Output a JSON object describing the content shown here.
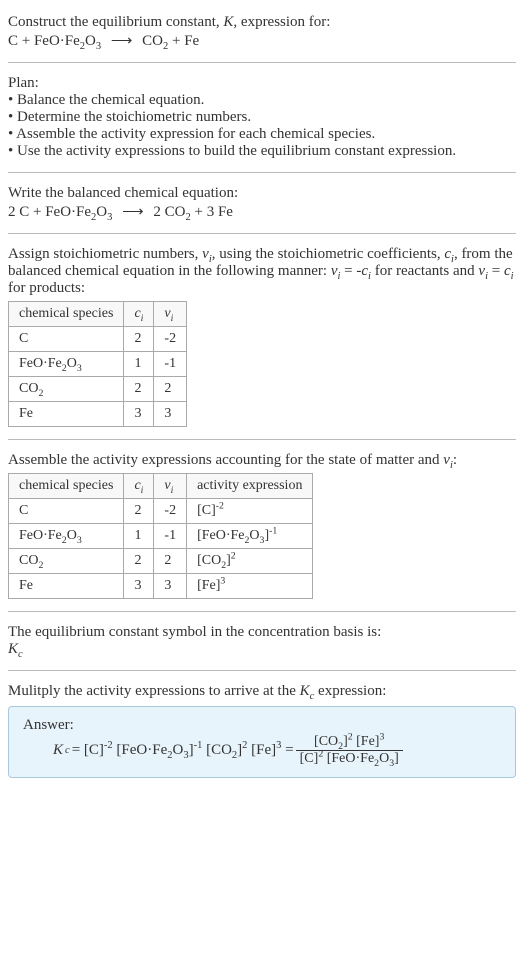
{
  "title_line1": "Construct the equilibrium constant, ",
  "title_K": "K",
  "title_line1b": ", expression for:",
  "eq_unbalanced": {
    "lhs": "C + FeO·Fe",
    "lhs_sub1": "2",
    "lhs_mid": "O",
    "lhs_sub2": "3",
    "rhs": "CO",
    "rhs_sub1": "2",
    "rhs_end": " + Fe"
  },
  "plan_header": "Plan:",
  "plan_items": [
    "• Balance the chemical equation.",
    "• Determine the stoichiometric numbers.",
    "• Assemble the activity expression for each chemical species.",
    "• Use the activity expressions to build the equilibrium constant expression."
  ],
  "balanced_header": "Write the balanced chemical equation:",
  "eq_balanced": {
    "l1": "2 C + FeO·Fe",
    "s1": "2",
    "l2": "O",
    "s2": "3",
    "r1": "2 CO",
    "rs1": "2",
    "r2": " + 3 Fe"
  },
  "assign_text_1": "Assign stoichiometric numbers, ",
  "nu_i": "ν",
  "i_sub": "i",
  "assign_text_2": ", using the stoichiometric coefficients, ",
  "c_i": "c",
  "assign_text_3": ", from the balanced chemical equation in the following manner: ",
  "assign_text_4": " = -",
  "assign_text_5": " for reactants and ",
  "assign_text_6": " = ",
  "assign_text_7": " for products:",
  "table1": {
    "headers": [
      "chemical species",
      "c_i",
      "nu_i"
    ],
    "rows": [
      {
        "species": "C",
        "ci": "2",
        "nui": "-2"
      },
      {
        "species_html": "FeO·Fe<sub>2</sub>O<sub>3</sub>",
        "ci": "1",
        "nui": "-1"
      },
      {
        "species_html": "CO<sub>2</sub>",
        "ci": "2",
        "nui": "2"
      },
      {
        "species": "Fe",
        "ci": "3",
        "nui": "3"
      }
    ]
  },
  "assemble_text_1": "Assemble the activity expressions accounting for the state of matter and ",
  "assemble_text_2": ":",
  "table2": {
    "headers": [
      "chemical species",
      "c_i",
      "nu_i",
      "activity expression"
    ],
    "rows": [
      {
        "species": "C",
        "ci": "2",
        "nui": "-2",
        "act_html": "[C]<sup>-2</sup>"
      },
      {
        "species_html": "FeO·Fe<sub>2</sub>O<sub>3</sub>",
        "ci": "1",
        "nui": "-1",
        "act_html": "[FeO·Fe<sub>2</sub>O<sub>3</sub>]<sup>-1</sup>"
      },
      {
        "species_html": "CO<sub>2</sub>",
        "ci": "2",
        "nui": "2",
        "act_html": "[CO<sub>2</sub>]<sup>2</sup>"
      },
      {
        "species": "Fe",
        "ci": "3",
        "nui": "3",
        "act_html": "[Fe]<sup>3</sup>"
      }
    ]
  },
  "eq_const_text": "The equilibrium constant symbol in the concentration basis is:",
  "K_c": "K",
  "c_sub": "c",
  "multiply_text_1": "Mulitply the activity expressions to arrive at the ",
  "multiply_text_2": " expression:",
  "answer_label": "Answer:",
  "answer_eq": {
    "lhs": "K",
    "eq_text_html": " = [C]<sup>-2</sup> [FeO·Fe<sub>2</sub>O<sub>3</sub>]<sup>-1</sup> [CO<sub>2</sub>]<sup>2</sup> [Fe]<sup>3</sup> = ",
    "num_html": "[CO<sub>2</sub>]<sup>2</sup> [Fe]<sup>3</sup>",
    "den_html": "[C]<sup>2</sup> [FeO·Fe<sub>2</sub>O<sub>3</sub>]"
  }
}
